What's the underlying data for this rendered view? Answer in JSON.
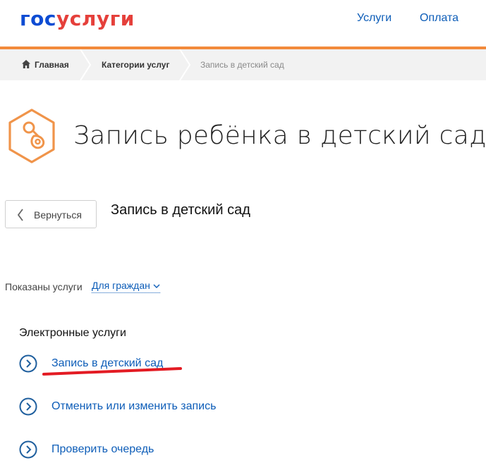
{
  "header": {
    "logo_part1": "гос",
    "logo_part2": "услуги",
    "nav": [
      {
        "label": "Услуги"
      },
      {
        "label": "Оплата"
      }
    ]
  },
  "breadcrumb": [
    {
      "label": "Главная"
    },
    {
      "label": "Категории услуг"
    },
    {
      "label": "Запись в детский сад"
    }
  ],
  "page": {
    "title": "Запись ребёнка в детский сад",
    "back_label": "Вернуться",
    "section_title": "Запись в детский сад"
  },
  "filter": {
    "label": "Показаны услуги",
    "value": "Для граждан"
  },
  "services": {
    "heading": "Электронные услуги",
    "items": [
      {
        "label": "Запись в детский сад"
      },
      {
        "label": "Отменить или изменить запись"
      },
      {
        "label": "Проверить очередь"
      }
    ]
  },
  "colors": {
    "brand_blue": "#0d4cd3",
    "brand_red": "#e5403b",
    "accent_orange": "#f28a3b",
    "link_blue": "#0d5db8",
    "highlight_red": "#e31b23"
  }
}
